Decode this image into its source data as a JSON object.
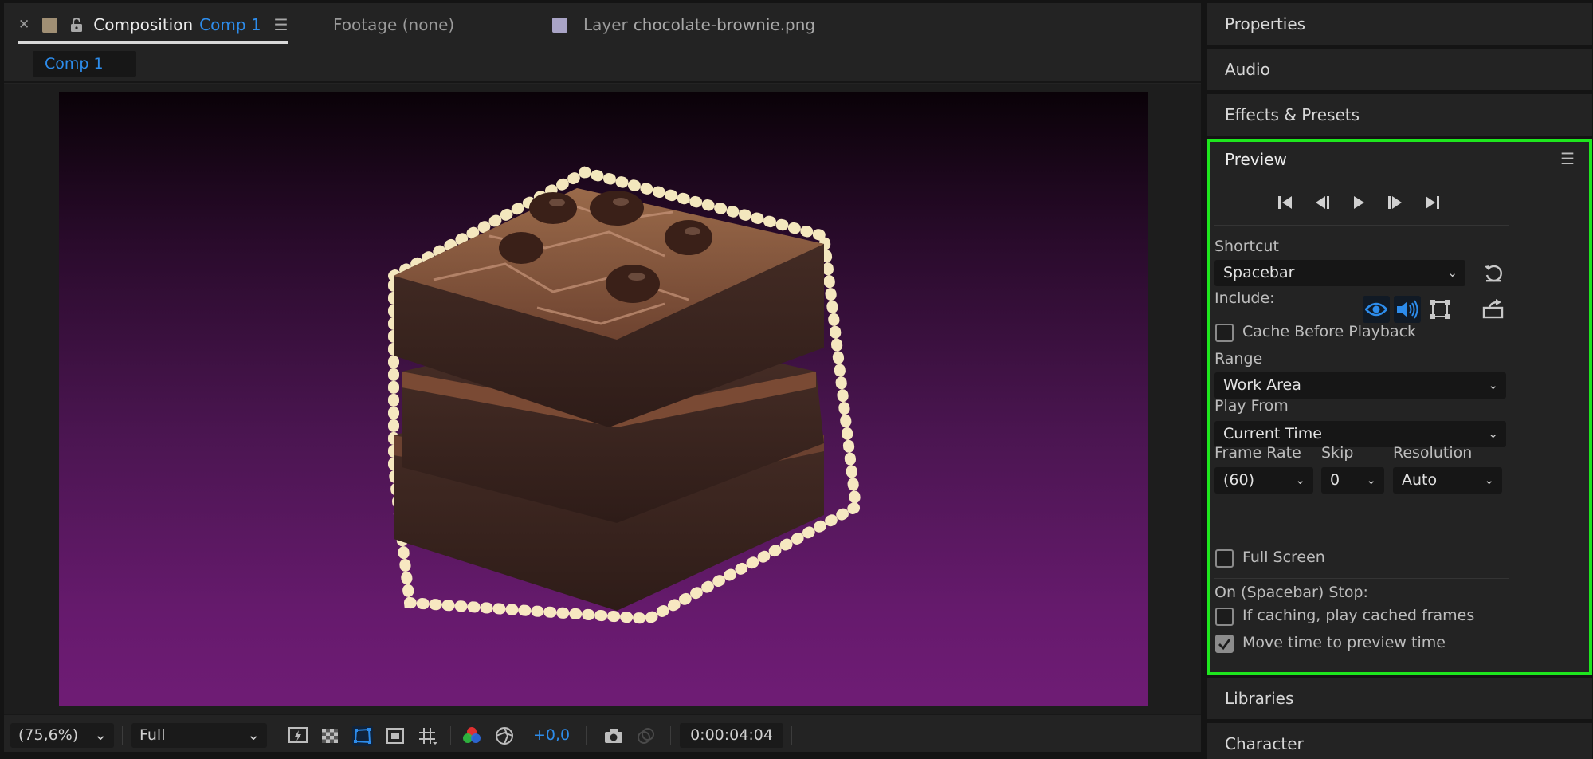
{
  "comp_tabs": {
    "composition_label": "Composition",
    "composition_name": "Comp 1",
    "footage_label": "Footage (none)",
    "layer_label": "Layer",
    "layer_name": "chocolate-brownie.png",
    "subtab": "Comp 1"
  },
  "status_bar": {
    "zoom": "(75,6%)",
    "resolution": "Full",
    "exposure": "+0,0",
    "timecode": "0:00:04:04"
  },
  "right_panels": {
    "properties": "Properties",
    "audio": "Audio",
    "effects_presets": "Effects & Presets",
    "libraries": "Libraries",
    "character": "Character"
  },
  "preview": {
    "title": "Preview",
    "shortcut_label": "Shortcut",
    "shortcut_value": "Spacebar",
    "include_label": "Include:",
    "cache_before_playback": "Cache Before Playback",
    "range_label": "Range",
    "range_value": "Work Area",
    "play_from_label": "Play From",
    "play_from_value": "Current Time",
    "frame_rate_label": "Frame Rate",
    "frame_rate_value": "(60)",
    "skip_label": "Skip",
    "skip_value": "0",
    "resolution_label": "Resolution",
    "resolution_value": "Auto",
    "full_screen": "Full Screen",
    "on_stop_label": "On (Spacebar) Stop:",
    "if_caching": "If caching, play cached frames",
    "move_time": "Move time to preview time"
  },
  "colors": {
    "accent": "#2d8ceb",
    "highlight": "#1ee61e",
    "comp_swatch": "#a08f74",
    "layer_swatch": "#a9a4c6"
  }
}
